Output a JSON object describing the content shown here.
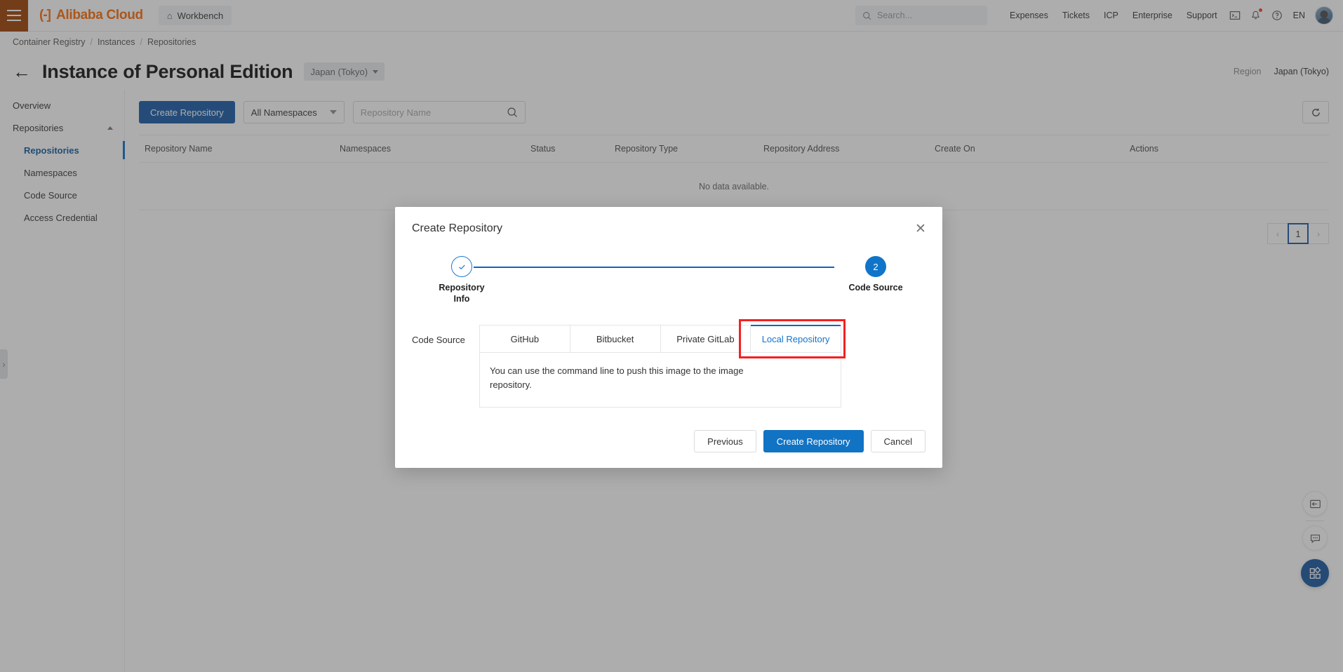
{
  "topbar": {
    "menu_icon": "hamburger-icon",
    "brand_mark": "(-]",
    "brand_text": "Alibaba Cloud",
    "workbench_label": "Workbench",
    "workbench_icon": "home-icon",
    "search_placeholder": "Search...",
    "search_icon": "search-icon",
    "links": [
      "Expenses",
      "Tickets",
      "ICP",
      "Enterprise",
      "Support"
    ],
    "icons": [
      "terminal-icon",
      "bell-icon",
      "help-icon"
    ],
    "language": "EN",
    "avatar": "user-avatar"
  },
  "breadcrumb": {
    "items": [
      "Container Registry",
      "Instances",
      "Repositories"
    ],
    "separator": "/"
  },
  "page_header": {
    "back_icon": "back-arrow-icon",
    "title": "Instance of Personal Edition",
    "region_pill": "Japan (Tokyo)",
    "region_label": "Region",
    "region_value": "Japan (Tokyo)"
  },
  "sidebar": {
    "items": [
      {
        "label": "Overview",
        "type": "item",
        "active": false
      },
      {
        "label": "Repositories",
        "type": "group",
        "active": false
      },
      {
        "label": "Repositories",
        "type": "sub",
        "active": true
      },
      {
        "label": "Namespaces",
        "type": "sub",
        "active": false
      },
      {
        "label": "Code Source",
        "type": "sub",
        "active": false
      },
      {
        "label": "Access Credential",
        "type": "sub",
        "active": false
      }
    ],
    "collapse_icon": "chevron-up-icon",
    "edge_tab_icon": "chevron-right-icon"
  },
  "toolbar": {
    "create_repository_label": "Create Repository",
    "namespace_select_value": "All Namespaces",
    "search_placeholder": "Repository Name",
    "search_icon": "search-icon",
    "refresh_icon": "refresh-icon"
  },
  "table": {
    "columns": [
      "Repository Name",
      "Namespaces",
      "Status",
      "Repository Type",
      "Repository Address",
      "Create On",
      "Actions"
    ],
    "rows": [],
    "empty_text": "No data available."
  },
  "pagination": {
    "prev_icon": "chevron-left-icon",
    "next_icon": "chevron-right-icon",
    "current_page": "1"
  },
  "dock": {
    "buttons": [
      {
        "icon": "collapse-panel-icon",
        "name": "collapse-panel-button"
      },
      {
        "icon": "feedback-chat-icon",
        "name": "feedback-button"
      },
      {
        "icon": "apps-grid-icon",
        "name": "apps-button"
      }
    ]
  },
  "modal": {
    "title": "Create Repository",
    "close_icon": "close-icon",
    "steps": [
      {
        "number": "✓",
        "label": "Repository\nInfo",
        "label_line1": "Repository",
        "label_line2": "Info",
        "state": "done"
      },
      {
        "number": "2",
        "label": "Code Source",
        "label_line1": "Code Source",
        "label_line2": "",
        "state": "active"
      }
    ],
    "form": {
      "code_source_label": "Code Source",
      "tabs": [
        {
          "label": "GitHub",
          "selected": false
        },
        {
          "label": "Bitbucket",
          "selected": false
        },
        {
          "label": "Private GitLab",
          "selected": false
        },
        {
          "label": "Local Repository",
          "selected": true
        }
      ],
      "panel_text": "You can use the command line to push this image to the image repository."
    },
    "footer": {
      "previous_label": "Previous",
      "create_label": "Create Repository",
      "cancel_label": "Cancel"
    },
    "highlight_color": "#f42121"
  }
}
